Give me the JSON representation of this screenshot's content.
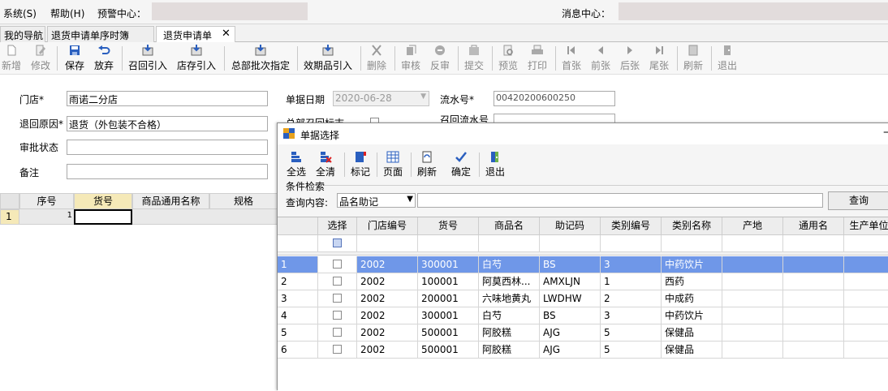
{
  "menu": {
    "system": "系统(S)",
    "help": "帮助(H)",
    "alert_center": "预警中心：",
    "message_center": "消息中心："
  },
  "tabs": [
    {
      "label": "我的导航"
    },
    {
      "label": "退货申请单序时簿"
    },
    {
      "label": "退货申请单"
    }
  ],
  "tab_close": "✕",
  "toolbar": {
    "new": "新增",
    "edit": "修改",
    "save": "保存",
    "discard": "放弃",
    "recall_import": "召回引入",
    "store_import": "店存引入",
    "hq_batch_assign": "总部批次指定",
    "expiry_import": "效期品引入",
    "delete": "删除",
    "audit": "审核",
    "unaudit": "反审",
    "submit": "提交",
    "preview": "预览",
    "print": "打印",
    "first": "首张",
    "prev": "前张",
    "next": "后张",
    "last": "尾张",
    "refresh": "刷新",
    "exit": "退出"
  },
  "form": {
    "store_label": "门店*",
    "store_value": "雨诺二分店",
    "reason_label": "退回原因*",
    "reason_value": "退货（外包装不合格）",
    "approval_label": "审批状态",
    "approval_value": "",
    "remark_label": "备注",
    "remark_value": "",
    "date_label": "单据日期",
    "date_value": "2020-06-28",
    "serial_label": "流水号*",
    "serial_value": "00420200600250",
    "hq_recall_label": "总部召回标志",
    "recall_serial_label": "召回流水号"
  },
  "main_grid": {
    "headers": [
      "序号",
      "货号",
      "商品通用名称",
      "规格"
    ],
    "rows": [
      {
        "num": "1",
        "seq": "1"
      }
    ]
  },
  "dialog": {
    "title": "单据选择",
    "toolbar": {
      "select_all": "全选",
      "clear_all": "全清",
      "mark": "标记",
      "page": "页面",
      "refresh": "刷新",
      "confirm": "确定",
      "exit": "退出"
    },
    "filter_group": "条件检索",
    "query_label": "查询内容:",
    "query_field": "品名助记",
    "query_value": "",
    "query_button": "查询",
    "columns": [
      "选择",
      "门店编号",
      "货号",
      "商品名",
      "助记码",
      "类别编号",
      "类别名称",
      "产地",
      "通用名",
      "生产单位"
    ],
    "rows": [
      {
        "num": "1",
        "store": "2002",
        "sku": "300001",
        "name": "白芍",
        "mnemonic": "BS",
        "cat_no": "3",
        "cat_name": "中药饮片"
      },
      {
        "num": "2",
        "store": "2002",
        "sku": "100001",
        "name": "阿莫西林...",
        "mnemonic": "AMXLJN",
        "cat_no": "1",
        "cat_name": "西药"
      },
      {
        "num": "3",
        "store": "2002",
        "sku": "200001",
        "name": "六味地黄丸",
        "mnemonic": "LWDHW",
        "cat_no": "2",
        "cat_name": "中成药"
      },
      {
        "num": "4",
        "store": "2002",
        "sku": "300001",
        "name": "白芍",
        "mnemonic": "BS",
        "cat_no": "3",
        "cat_name": "中药饮片"
      },
      {
        "num": "5",
        "store": "2002",
        "sku": "500001",
        "name": "阿胶糕",
        "mnemonic": "AJG",
        "cat_no": "5",
        "cat_name": "保健品"
      },
      {
        "num": "6",
        "store": "2002",
        "sku": "500001",
        "name": "阿胶糕",
        "mnemonic": "AJG",
        "cat_no": "5",
        "cat_name": "保健品"
      }
    ]
  },
  "colors": {
    "selection": "#6f97e8",
    "active_cell": "#f5e9b8",
    "blue_icon": "#2a5fbf"
  }
}
